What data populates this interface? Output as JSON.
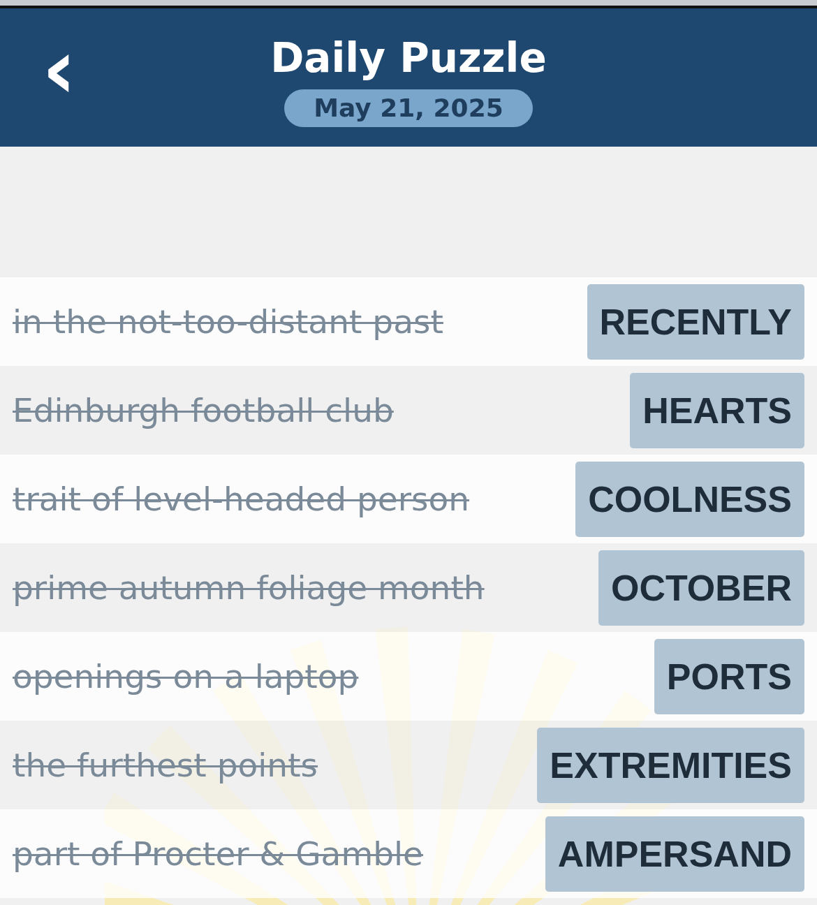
{
  "header": {
    "back": "‹",
    "title": "Daily Puzzle",
    "date": "May 21, 2025"
  },
  "clues": [
    {
      "clue": "in the not-too-distant past",
      "answer": "RECENTLY",
      "solved": true
    },
    {
      "clue": "Edinburgh football club",
      "answer": "HEARTS",
      "solved": true
    },
    {
      "clue": "trait of level-headed person",
      "answer": "COOLNESS",
      "solved": true
    },
    {
      "clue": "prime autumn foliage month",
      "answer": "OCTOBER",
      "solved": true
    },
    {
      "clue": "openings on a laptop",
      "answer": "PORTS",
      "solved": true
    },
    {
      "clue": "the furthest points",
      "answer": "EXTREMITIES",
      "solved": true
    },
    {
      "clue": "part of Procter & Gamble",
      "answer": "AMPERSAND",
      "solved": true
    }
  ]
}
